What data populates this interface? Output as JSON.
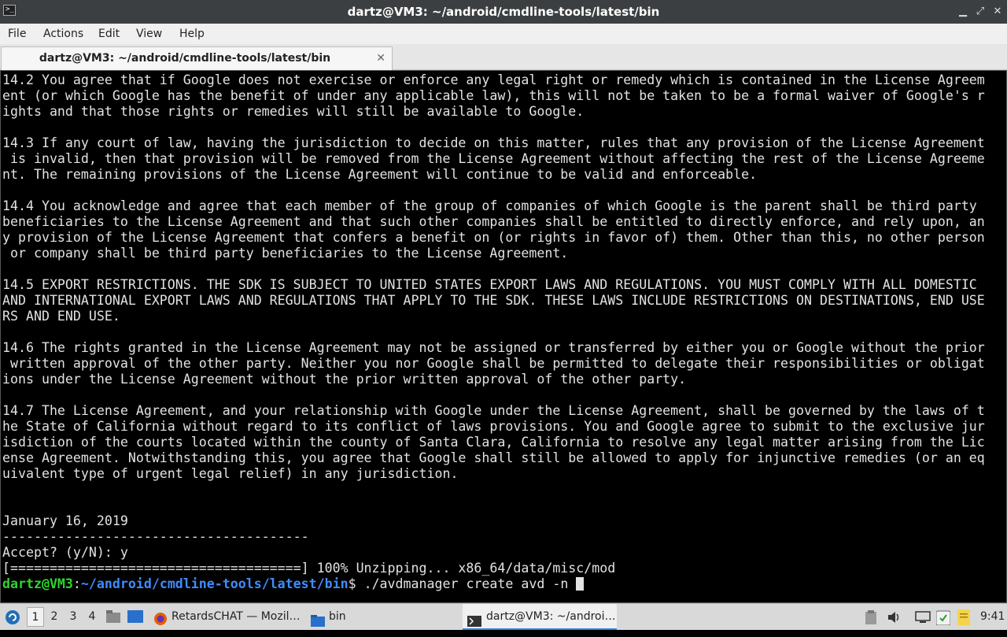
{
  "window": {
    "title": "dartz@VM3: ~/android/cmdline-tools/latest/bin",
    "app_icon_glyph": ">_",
    "minimize_glyph": "▁",
    "maximize_glyph": "⤢",
    "close_glyph": "✕"
  },
  "menu": {
    "file": "File",
    "actions": "Actions",
    "edit": "Edit",
    "view": "View",
    "help": "Help"
  },
  "tab": {
    "label": "dartz@VM3: ~/android/cmdline-tools/latest/bin",
    "close_glyph": "✕"
  },
  "terminal": {
    "lines": [
      "14.2 You agree that if Google does not exercise or enforce any legal right or remedy which is contained in the License Agreem",
      "ent (or which Google has the benefit of under any applicable law), this will not be taken to be a formal waiver of Google's r",
      "ights and that those rights or remedies will still be available to Google.",
      "",
      "14.3 If any court of law, having the jurisdiction to decide on this matter, rules that any provision of the License Agreement",
      " is invalid, then that provision will be removed from the License Agreement without affecting the rest of the License Agreeme",
      "nt. The remaining provisions of the License Agreement will continue to be valid and enforceable.",
      "",
      "14.4 You acknowledge and agree that each member of the group of companies of which Google is the parent shall be third party",
      "beneficiaries to the License Agreement and that such other companies shall be entitled to directly enforce, and rely upon, an",
      "y provision of the License Agreement that confers a benefit on (or rights in favor of) them. Other than this, no other person",
      " or company shall be third party beneficiaries to the License Agreement.",
      "",
      "14.5 EXPORT RESTRICTIONS. THE SDK IS SUBJECT TO UNITED STATES EXPORT LAWS AND REGULATIONS. YOU MUST COMPLY WITH ALL DOMESTIC",
      "AND INTERNATIONAL EXPORT LAWS AND REGULATIONS THAT APPLY TO THE SDK. THESE LAWS INCLUDE RESTRICTIONS ON DESTINATIONS, END USE",
      "RS AND END USE.",
      "",
      "14.6 The rights granted in the License Agreement may not be assigned or transferred by either you or Google without the prior",
      " written approval of the other party. Neither you nor Google shall be permitted to delegate their responsibilities or obligat",
      "ions under the License Agreement without the prior written approval of the other party.",
      "",
      "14.7 The License Agreement, and your relationship with Google under the License Agreement, shall be governed by the laws of t",
      "he State of California without regard to its conflict of laws provisions. You and Google agree to submit to the exclusive jur",
      "isdiction of the courts located within the county of Santa Clara, California to resolve any legal matter arising from the Lic",
      "ense Agreement. Notwithstanding this, you agree that Google shall still be allowed to apply for injunctive remedies (or an eq",
      "uivalent type of urgent legal relief) in any jurisdiction.",
      "",
      "",
      "January 16, 2019",
      "---------------------------------------",
      "Accept? (y/N): y",
      "[=====================================] 100% Unzipping... x86_64/data/misc/mod"
    ],
    "prompt_user": "dartz@VM3",
    "prompt_sep": ":",
    "prompt_path": "~/android/cmdline-tools/latest/bin",
    "prompt_end": "$ ",
    "command": "./avdmanager create avd -n "
  },
  "taskbar": {
    "workspaces": [
      "1",
      "2",
      "3",
      "4"
    ],
    "active_workspace": "1",
    "task_firefox": "RetardsCHAT — Mozil…",
    "task_files": "bin",
    "task_terminal": "dartz@VM3: ~/androi…",
    "clock": "9:41"
  },
  "colors": {
    "prompt_user": "#2ed62e",
    "prompt_path": "#3f8cff",
    "terminal_bg": "#000000",
    "terminal_fg": "#e2e2e2"
  }
}
